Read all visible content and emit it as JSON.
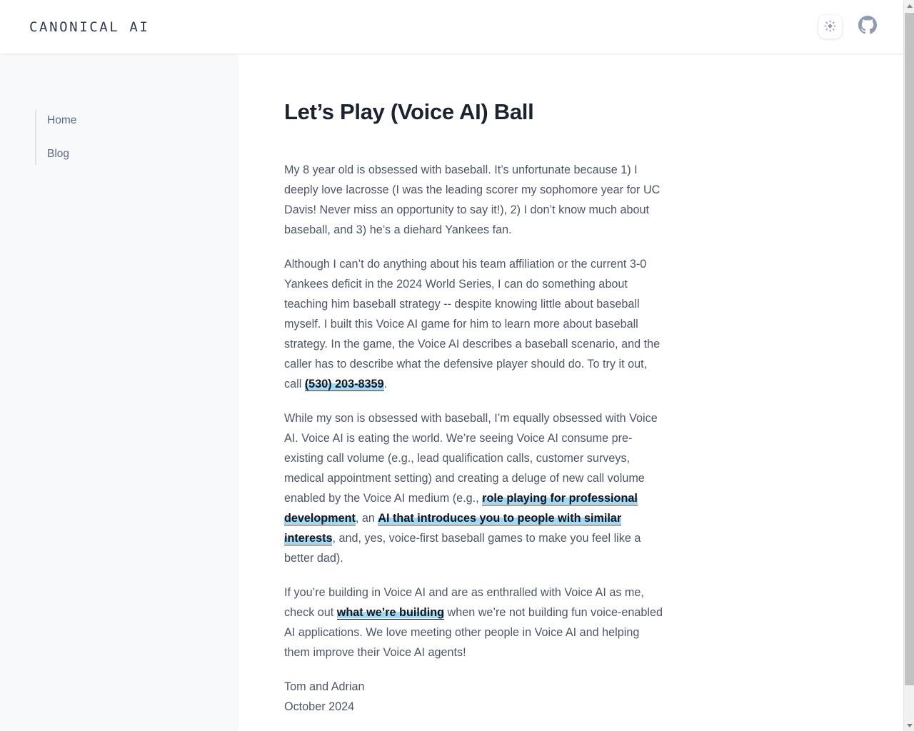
{
  "header": {
    "brand": "CANONICAL AI",
    "theme_toggle_icon": "sun-icon",
    "github_icon": "github-icon"
  },
  "sidebar": {
    "items": [
      {
        "label": "Home"
      },
      {
        "label": "Blog"
      }
    ]
  },
  "article": {
    "title": "Let’s Play (Voice AI) Ball",
    "paragraphs": {
      "p1": "My 8 year old is obsessed with baseball. It’s unfortunate because 1) I deeply love lacrosse (I was the leading scorer my sophomore year for UC Davis! Never miss an opportunity to say it!), 2) I don’t know much about baseball, and 3) he’s a diehard Yankees fan.",
      "p2_before": "Although I can’t do anything about his team affiliation or the current 3-0 Yankees deficit in the 2024 World Series, I can do something about teaching him baseball strategy -- despite knowing little about baseball myself. I built this Voice AI game for him to learn more about baseball strategy. In the game, the Voice AI describes a baseball scenario, and the caller has to describe what the defensive player should do. To try it out, call ",
      "p2_link": "(530) 203-8359",
      "p2_after": ".",
      "p3_before": "While my son is obsessed with baseball, I’m equally obsessed with Voice AI. Voice AI is eating the world. We’re seeing Voice AI consume pre-existing call volume (e.g., lead qualification calls, customer surveys, medical appointment setting) and creating a deluge of new call volume enabled by the Voice AI medium (e.g., ",
      "p3_link1": "role playing for professional development",
      "p3_mid": ", an ",
      "p3_link2": "AI that introduces you to people with similar interests",
      "p3_after": ", and, yes, voice-first baseball games to make you feel like a better dad).",
      "p4_before": "If you’re building in Voice AI and are as enthralled with Voice AI as me, check out ",
      "p4_link": "what we’re building",
      "p4_after": " when we’re not building fun voice-enabled AI applications. We love meeting other people in Voice AI and helping them improve their Voice AI agents!"
    },
    "signoff": {
      "authors": "Tom and Adrian",
      "date": "October 2024"
    }
  },
  "colors": {
    "link_highlight": "#9fdaf8",
    "text": "#4c5668",
    "heading": "#1b2230",
    "sidebar_bg": "#f7f9fb",
    "brand": "#2e3a52"
  }
}
